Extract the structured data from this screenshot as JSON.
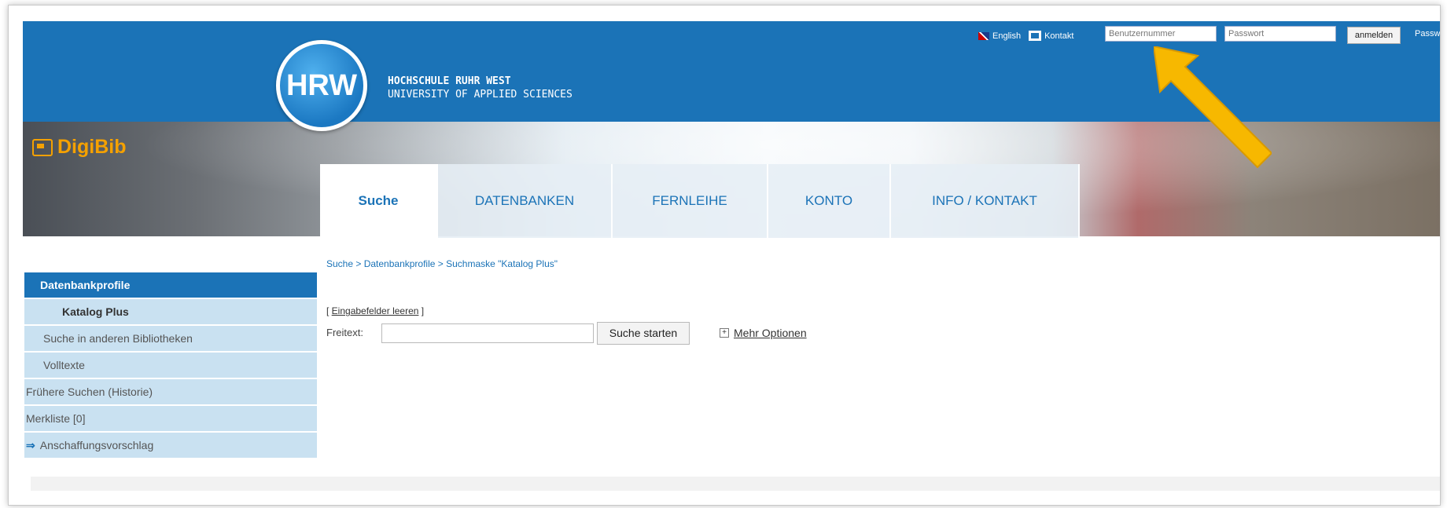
{
  "header": {
    "logo_text": "HRW",
    "school_name_line1": "HOCHSCHULE RUHR WEST",
    "school_name_line2": "UNIVERSITY OF APPLIED SCIENCES",
    "app_name": "DigiBib",
    "language_link": "English",
    "contact_link": "Kontakt",
    "login": {
      "username_placeholder": "Benutzernummer",
      "password_placeholder": "Passwort",
      "login_button": "anmelden",
      "password_link": "Passw"
    }
  },
  "tabs": [
    {
      "label": "Suche",
      "active": true
    },
    {
      "label": "DATENBANKEN",
      "active": false
    },
    {
      "label": "FERNLEIHE",
      "active": false
    },
    {
      "label": "KONTO",
      "active": false
    },
    {
      "label": "INFO / KONTAKT",
      "active": false
    }
  ],
  "breadcrumb": "Suche > Datenbankprofile > Suchmaske \"Katalog Plus\"",
  "sidebar": {
    "items": [
      {
        "label": "Datenbankprofile"
      },
      {
        "label": "Katalog Plus"
      },
      {
        "label": "Suche in anderen Bibliotheken"
      },
      {
        "label": "Volltexte"
      },
      {
        "label": "Frühere Suchen (Historie)"
      },
      {
        "label": "Merkliste [0]"
      },
      {
        "label": "Anschaffungsvorschlag"
      }
    ]
  },
  "search": {
    "clear_fields_prefix": "[ ",
    "clear_fields_link": "Eingabefelder leeren",
    "clear_fields_suffix": " ]",
    "freitext_label": "Freitext:",
    "freitext_value": "",
    "submit_label": "Suche starten",
    "more_options": "Mehr Optionen"
  },
  "colors": {
    "brand_blue": "#1b73b7",
    "accent_orange": "#f5a100",
    "sidebar_bg": "#c9e1f1",
    "annotation_arrow": "#f7b800"
  }
}
